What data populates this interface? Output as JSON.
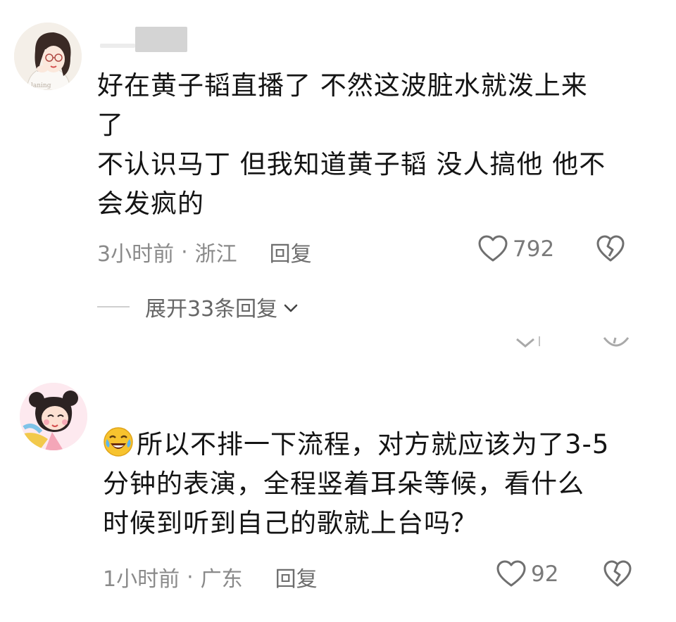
{
  "comments": [
    {
      "lines": [
        "好在黄子韬直播了 不然这波脏水就泼上来",
        "了",
        "不认识马丁 但我知道黄子韬 没人搞他 他不",
        "会发疯的"
      ],
      "time": "3小时前",
      "location": "浙江",
      "reply_label": "回复",
      "likes": "792",
      "expand_label": "展开33条回复"
    },
    {
      "lines": [
        "所以不排一下流程，对方就应该为了3-5",
        "分钟的表演，全程竖着耳朵等候，看什么",
        "时候到听到自己的歌就上台吗？"
      ],
      "time": "1小时前",
      "location": "广东",
      "reply_label": "回复",
      "likes": "92"
    }
  ],
  "separator": "·",
  "colors": {
    "text": "#141414",
    "meta": "#8a8a8a",
    "icon": "#7a7a7a"
  }
}
